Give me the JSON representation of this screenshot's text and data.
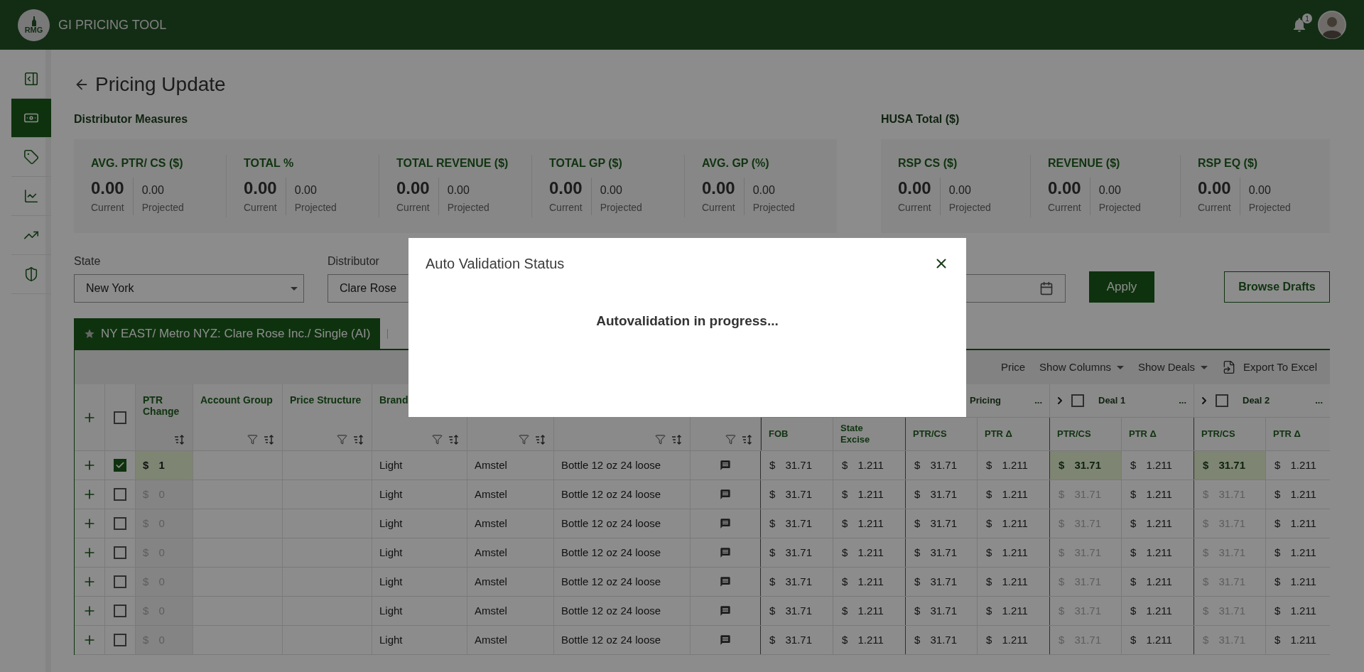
{
  "app": {
    "logo_text": "RMG",
    "title": "GI PRICING TOOL",
    "notifications": "1"
  },
  "sidebar": {
    "items": [
      {
        "kind": "toggle",
        "selected": false
      },
      {
        "kind": "banknote",
        "selected": true
      },
      {
        "kind": "tag",
        "selected": false
      },
      {
        "kind": "chart",
        "selected": false
      },
      {
        "kind": "trend",
        "selected": false
      },
      {
        "kind": "shield",
        "selected": false
      }
    ]
  },
  "page_title": "Pricing Update",
  "measure_groups": [
    {
      "title": "Distributor Measures",
      "metrics": [
        {
          "label": "AVG. PTR/ CS ($)",
          "current": "0.00",
          "current_label": "Current",
          "projected": "0.00",
          "projected_label": "Projected"
        },
        {
          "label": "TOTAL %",
          "current": "0.00",
          "current_label": "Current",
          "projected": "0.00",
          "projected_label": "Projected"
        },
        {
          "label": "TOTAL REVENUE ($)",
          "current": "0.00",
          "current_label": "Current",
          "projected": "0.00",
          "projected_label": "Projected"
        },
        {
          "label": "TOTAL GP ($)",
          "current": "0.00",
          "current_label": "Current",
          "projected": "0.00",
          "projected_label": "Projected"
        },
        {
          "label": "AVG. GP (%)",
          "current": "0.00",
          "current_label": "Current",
          "projected": "0.00",
          "projected_label": "Projected"
        }
      ]
    },
    {
      "title": "HUSA Total ($)",
      "metrics": [
        {
          "label": "RSP CS ($)",
          "current": "0.00",
          "current_label": "Current",
          "projected": "0.00",
          "projected_label": "Projected"
        },
        {
          "label": "REVENUE ($)",
          "current": "0.00",
          "current_label": "Current",
          "projected": "0.00",
          "projected_label": "Projected"
        },
        {
          "label": "RSP EQ ($)",
          "current": "0.00",
          "current_label": "Current",
          "projected": "0.00",
          "projected_label": "Projected"
        }
      ]
    }
  ],
  "filters": {
    "state": {
      "label": "State",
      "value": "New York"
    },
    "distributor": {
      "label": "Distributor",
      "value": "Clare Rose"
    },
    "apply": "Apply",
    "browse_drafts": "Browse Drafts"
  },
  "tabs": [
    {
      "label": "NY EAST/ Metro NYZ: Clare Rose Inc./ Single (AI)",
      "selected": true
    }
  ],
  "toolbar": {
    "items": [
      {
        "kind": "text",
        "label": "Price"
      },
      {
        "kind": "dropdown",
        "label": "Show Columns"
      },
      {
        "kind": "dropdown",
        "label": "Show Deals"
      },
      {
        "kind": "export",
        "label": "Export To Excel"
      }
    ]
  },
  "table": {
    "all_selected": false,
    "left_columns": [
      {
        "label": "PTR Change",
        "filter": false,
        "sort": true
      },
      {
        "label": "Account Group",
        "filter": true,
        "sort": true
      },
      {
        "label": "Price Structure",
        "filter": true,
        "sort": true
      },
      {
        "label": "Brand",
        "filter": true,
        "sort": true
      },
      {
        "filter": true,
        "sort": true
      },
      {
        "filter": true,
        "sort": true
      },
      {
        "filter": true,
        "sort": true
      }
    ],
    "groups": [
      {
        "kind": "plain",
        "columns": [
          "FOB",
          "State Excise"
        ]
      },
      {
        "kind": "pricing",
        "title": "Pricing",
        "menu": "...",
        "columns": [
          "PTR/CS",
          "PTR Δ"
        ]
      },
      {
        "kind": "deal",
        "title": "Deal 1",
        "menu": "...",
        "checked": false,
        "expanded": false,
        "columns": [
          "PTR/CS",
          "PTR Δ"
        ]
      },
      {
        "kind": "deal",
        "title": "Deal 2",
        "menu": "...",
        "checked": false,
        "expanded": false,
        "columns": [
          "PTR/CS",
          "PTR Δ"
        ]
      }
    ],
    "rows": [
      {
        "selected": true,
        "ptr_change": "$ 1",
        "tier": "Light",
        "brand": "Amstel",
        "package": "Bottle 12 oz 24 loose",
        "values": [
          "$ 31.71",
          "$ 1.211",
          "$ 31.71",
          "$ 1.211",
          "$ 31.71",
          "$ 1.211",
          "$ 31.71",
          "$ 1.211"
        ]
      },
      {
        "selected": false,
        "ptr_change": "$ 0",
        "tier": "Light",
        "brand": "Amstel",
        "package": "Bottle 12 oz 24 loose",
        "values": [
          "$ 31.71",
          "$ 1.211",
          "$ 31.71",
          "$ 1.211",
          "$ 31.71",
          "$ 1.211",
          "$ 31.71",
          "$ 1.211"
        ]
      },
      {
        "selected": false,
        "ptr_change": "$ 0",
        "tier": "Light",
        "brand": "Amstel",
        "package": "Bottle 12 oz 24 loose",
        "values": [
          "$ 31.71",
          "$ 1.211",
          "$ 31.71",
          "$ 1.211",
          "$ 31.71",
          "$ 1.211",
          "$ 31.71",
          "$ 1.211"
        ]
      },
      {
        "selected": false,
        "ptr_change": "$ 0",
        "tier": "Light",
        "brand": "Amstel",
        "package": "Bottle 12 oz 24 loose",
        "values": [
          "$ 31.71",
          "$ 1.211",
          "$ 31.71",
          "$ 1.211",
          "$ 31.71",
          "$ 1.211",
          "$ 31.71",
          "$ 1.211"
        ]
      },
      {
        "selected": false,
        "ptr_change": "$ 0",
        "tier": "Light",
        "brand": "Amstel",
        "package": "Bottle 12 oz 24 loose",
        "values": [
          "$ 31.71",
          "$ 1.211",
          "$ 31.71",
          "$ 1.211",
          "$ 31.71",
          "$ 1.211",
          "$ 31.71",
          "$ 1.211"
        ]
      },
      {
        "selected": false,
        "ptr_change": "$ 0",
        "tier": "Light",
        "brand": "Amstel",
        "package": "Bottle 12 oz 24 loose",
        "values": [
          "$ 31.71",
          "$ 1.211",
          "$ 31.71",
          "$ 1.211",
          "$ 31.71",
          "$ 1.211",
          "$ 31.71",
          "$ 1.211"
        ]
      },
      {
        "selected": false,
        "ptr_change": "$ 0",
        "tier": "Light",
        "brand": "Amstel",
        "package": "Bottle 12 oz 24 loose",
        "values": [
          "$ 31.71",
          "$ 1.211",
          "$ 31.71",
          "$ 1.211",
          "$ 31.71",
          "$ 1.211",
          "$ 31.71",
          "$ 1.211"
        ]
      }
    ]
  },
  "dialog": {
    "title": "Auto Validation Status",
    "message": "Autovalidation in progress..."
  }
}
